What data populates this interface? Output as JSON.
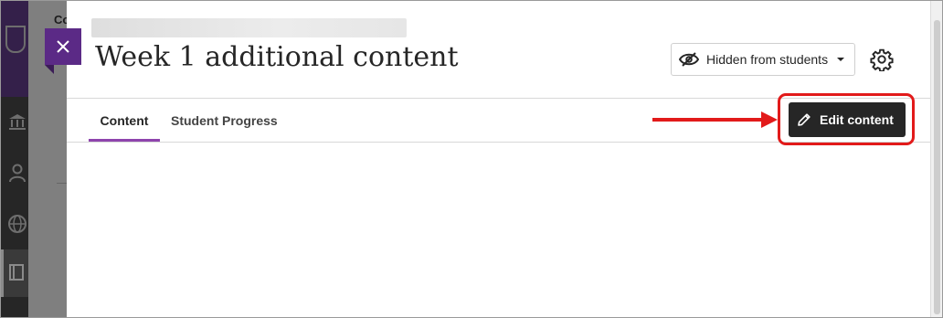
{
  "background": {
    "nav_text": "Co",
    "icons": [
      "university-icon",
      "user-icon",
      "globe-icon",
      "courses-icon"
    ]
  },
  "panel": {
    "close_icon": "close-icon",
    "title": "Week 1 additional content",
    "visibility": {
      "label": "Hidden from students",
      "icon": "eye-slash-icon"
    },
    "settings_icon": "gear-icon",
    "tabs": [
      {
        "label": "Content",
        "active": true
      },
      {
        "label": "Student Progress",
        "active": false
      }
    ],
    "edit_button": {
      "label": "Edit content",
      "icon": "pencil-icon"
    }
  },
  "annotation": {
    "color": "#e21a1a"
  },
  "colors": {
    "accent_purple": "#5b2a86",
    "tab_underline": "#8e44ad",
    "dark_button": "#262626"
  }
}
